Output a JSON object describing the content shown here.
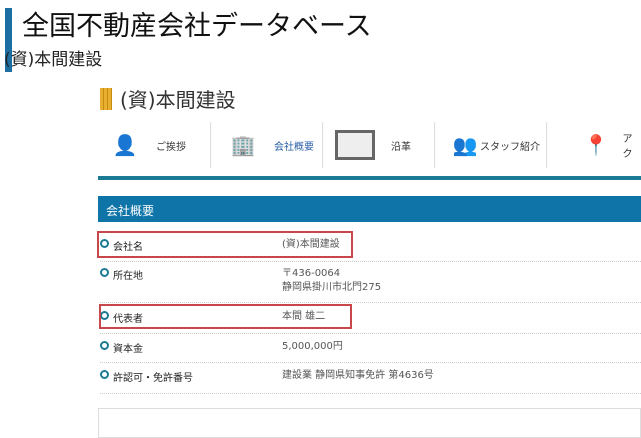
{
  "header": {
    "title": "全国不動産会社データベース",
    "subtitle": "(資)本間建設"
  },
  "company": {
    "name": "(資)本間建設"
  },
  "nav": [
    {
      "label": "ご挨拶",
      "icon": "greeting-person-icon"
    },
    {
      "label": "会社概要",
      "icon": "building-icon",
      "active": true
    },
    {
      "label": "沿革",
      "icon": "book-icon"
    },
    {
      "label": "スタッフ紹介",
      "icon": "staff-icon"
    },
    {
      "label": "アク",
      "icon": "map-pin-icon"
    }
  ],
  "section": {
    "title": "会社概要"
  },
  "rows": [
    {
      "key": "会社名",
      "value": "(資)本間建設",
      "highlighted": true
    },
    {
      "key": "所在地",
      "value": "〒436-0064",
      "value2": "静岡県掛川市北門275"
    },
    {
      "key": "代表者",
      "value": "本間 雄二",
      "highlighted": true
    },
    {
      "key": "資本金",
      "value": "5,000,000円"
    },
    {
      "key": "許認可・免許番号",
      "value": "建設業 静岡県知事免許 第4636号"
    }
  ],
  "colors": {
    "accent": "#0f75a8",
    "teal": "#1b7a94",
    "highlight": "#c8474a",
    "active_link": "#2a5fa8"
  }
}
